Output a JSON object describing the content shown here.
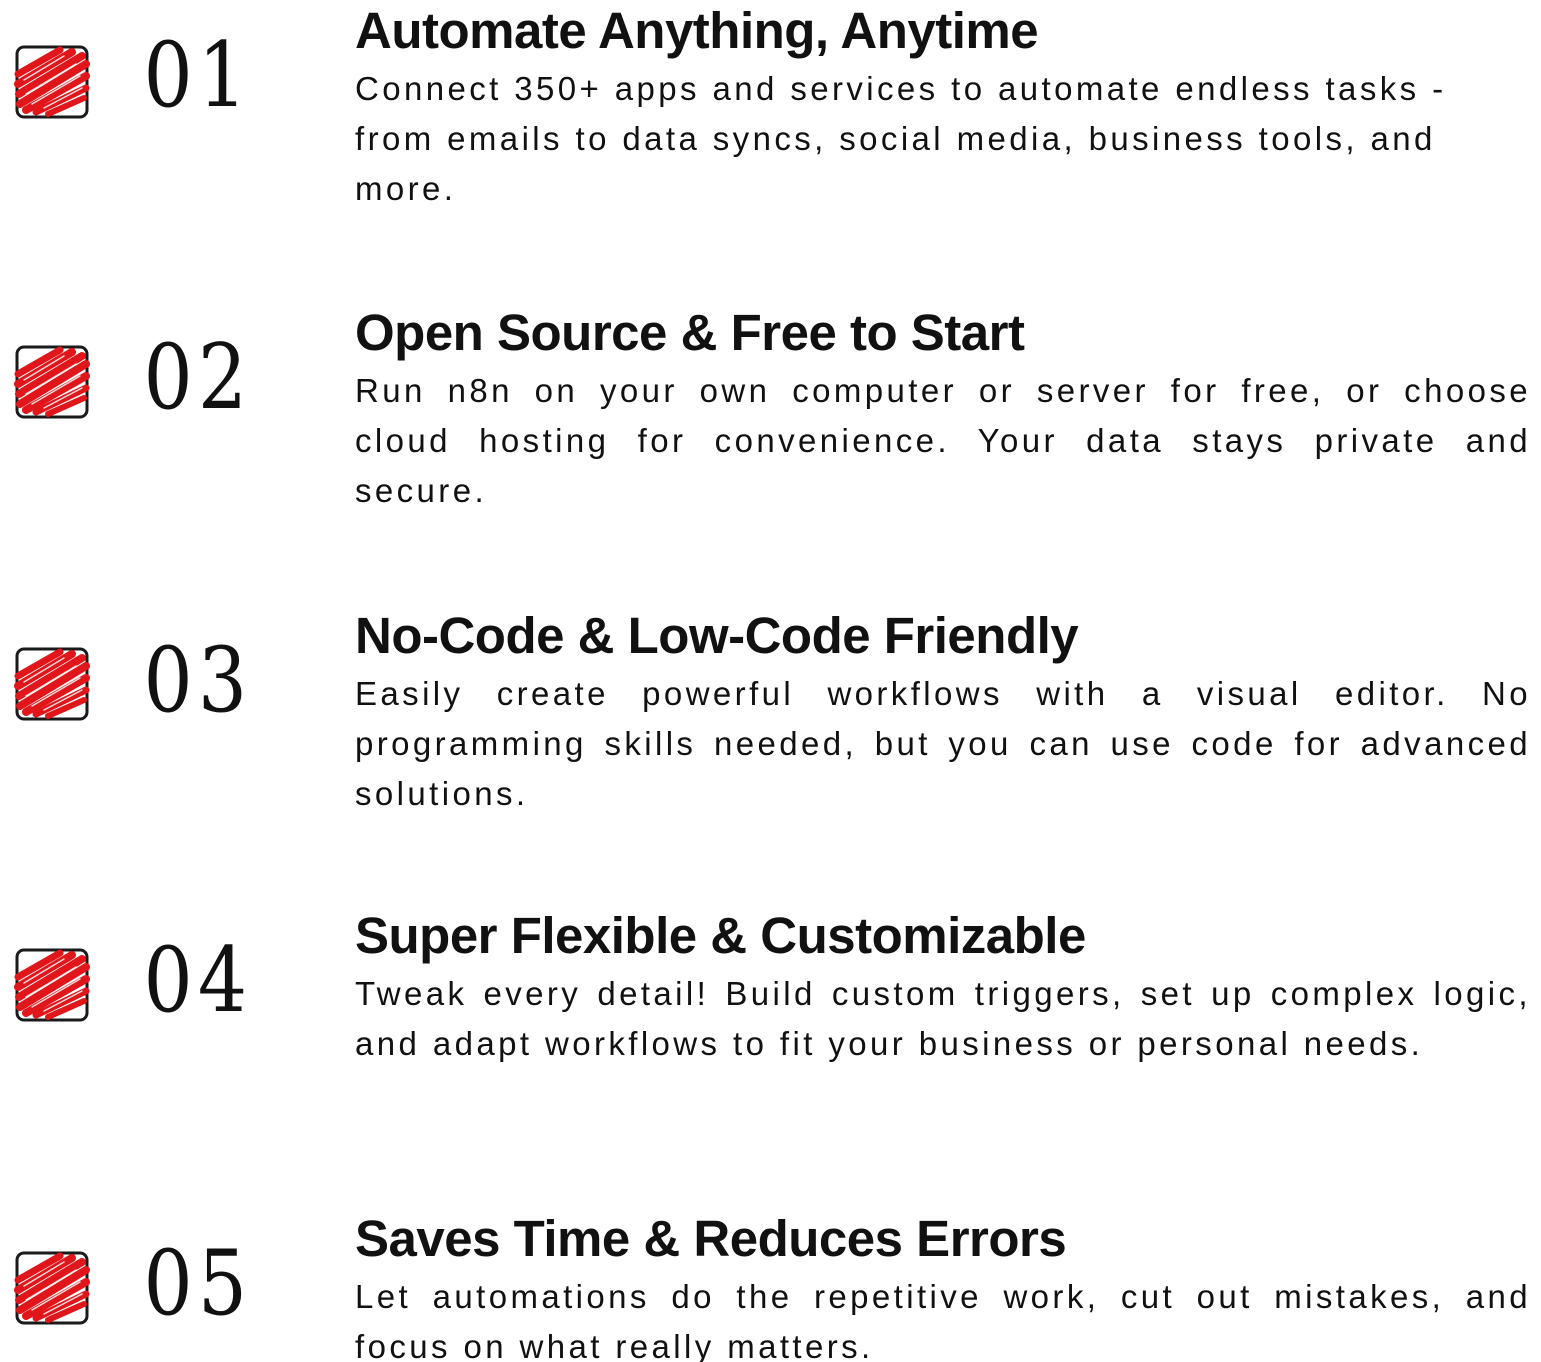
{
  "accent_color": "#e0161b",
  "icon": "red-scribble-checkbox-icon",
  "features": [
    {
      "number": "01",
      "title": "Automate Anything, Anytime",
      "description": "Connect 350+ apps and services to automate endless tasks - from emails to data syncs, social media, business tools, and more."
    },
    {
      "number": "02",
      "title": "Open Source & Free to Start",
      "description": "Run n8n on your own computer or server for free, or choose cloud hosting for convenience. Your data stays private and secure."
    },
    {
      "number": "03",
      "title": "No-Code & Low-Code Friendly",
      "description": "Easily create powerful workflows with a visual editor. No programming skills needed, but you can use code for advanced solutions."
    },
    {
      "number": "04",
      "title": "Super Flexible & Customizable",
      "description": "Tweak every detail! Build custom triggers, set up complex logic, and adapt workflows to fit your business or personal needs."
    },
    {
      "number": "05",
      "title": "Saves Time & Reduces Errors",
      "description": "Let automations do the repetitive work, cut out mistakes, and focus on what really matters."
    }
  ]
}
